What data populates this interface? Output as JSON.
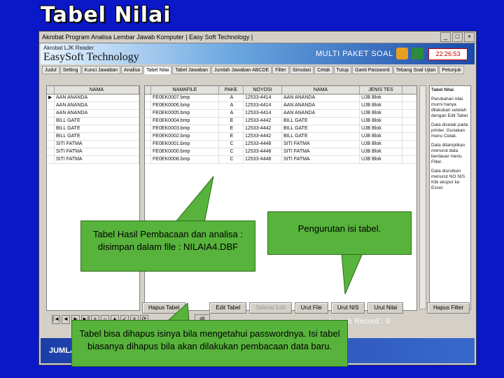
{
  "slide": {
    "title": "Tabel Nilai"
  },
  "window": {
    "title": "Akrobat   Program Analisa Lembar Jawab Komputer  |  Easy Soft Technology  |",
    "controls": [
      "_",
      "□",
      "×"
    ],
    "banner_sub": "Akrobat LJK Reader",
    "brand": "EasySoft Technology",
    "multi": "MULTI PAKET SOAL",
    "time": "22:26:53"
  },
  "tabs": [
    {
      "label": "Judul"
    },
    {
      "label": "Setting"
    },
    {
      "label": "Kunci Jawaban"
    },
    {
      "label": "Analisa"
    },
    {
      "label": "Tabel Nilai",
      "active": true
    },
    {
      "label": "Tabel Jawaban"
    },
    {
      "label": "Jumlah Jawaban ABCDE"
    },
    {
      "label": "Filter"
    },
    {
      "label": "Simulasi"
    },
    {
      "label": "Cetak"
    },
    {
      "label": "Tutup"
    },
    {
      "label": "Ganti Password"
    },
    {
      "label": "Tebang Soal Ujian"
    },
    {
      "label": "Petunjuk"
    }
  ],
  "left_grid": {
    "header": "NAMA",
    "rows": [
      "AAN ANANDA",
      "AAN ANANDA",
      "AAN ANANDA",
      "BILL GATE",
      "BILL GATE",
      "BILL GATE",
      "SITI FATMA",
      "SITI FATMA",
      "SITI FATMA"
    ]
  },
  "main_grid": {
    "columns": [
      "NAMAFILE",
      "PAKE",
      "NOYOSI",
      "NAMA",
      "JENIS TES"
    ],
    "rows": [
      [
        "FE0EK0007.bmp",
        "A",
        "12533-4414",
        "AAN ANANDA",
        "UJB Blok"
      ],
      [
        "FE0EK0006.bmp",
        "A",
        "12533-4414",
        "AAN ANANDA",
        "UJB Blok"
      ],
      [
        "FE0EK0005.bmp",
        "A",
        "12533-4414",
        "AAN ANANDA",
        "UJB Blok"
      ],
      [
        "FE0EK0004.bmp",
        "E",
        "12533-4442",
        "BILL GATE",
        "UJB Blok"
      ],
      [
        "FE0EK0003.bmp",
        "E",
        "12533-4442",
        "BILL GATE",
        "UJB Blok"
      ],
      [
        "FE0EK0002.bmp",
        "E",
        "12533-4442",
        "BILL GATE",
        "UJB Blok"
      ],
      [
        "FE0EK0001.bmp",
        "C",
        "12533-4448",
        "SITI FATMA",
        "UJB Blok"
      ],
      [
        "FE0EK0000.bmp",
        "C",
        "12533-4448",
        "SITI FATMA",
        "UJB Blok"
      ],
      [
        "FE0EK0008.bmp",
        "C",
        "12533-4448",
        "SITI FATMA",
        "UJB Blok"
      ]
    ]
  },
  "side_note": {
    "heading": "Tabel Nilai",
    "paragraphs": [
      "Perubahan nilai murni hanya dilakukan setelah dengan Edit Tabel.",
      "Data dicetak pada printer. Gunakan menu Cetak.",
      "Data ditampilkan menurut data berdasar menu Filter.",
      "Data diurutkan menurut NO NIS. Klik ekspor ke Excel."
    ]
  },
  "buttons": {
    "hapus": "Hapus Tabel",
    "edit": "Edit Tabel",
    "selesai": "Selesai Edit",
    "urut_file": "Urut File",
    "urut_nis": "Urut NIS",
    "urut_nilai": "Urut Nilai",
    "hapus_filter": "Hapus Filter",
    "ok": "ok"
  },
  "navigator": [
    "|◄",
    "◄",
    "►",
    "►|",
    "+",
    "−",
    "▲",
    "✓",
    "×",
    "⟳"
  ],
  "status": {
    "jumlah_record": "Jumlah Record : 9",
    "footer_label": "JUMLA"
  },
  "callouts": {
    "c1": "Tabel Hasil Pembacaan dan analisa : disimpan dalam file : NILAIA4.DBF",
    "c2": "Pengurutan isi tabel.",
    "c3": "Tabel bisa dihapus isinya bila mengetahui passwordnya. Isi tabel biasanya dihapus bila akan dilakukan pembacaan data baru."
  }
}
